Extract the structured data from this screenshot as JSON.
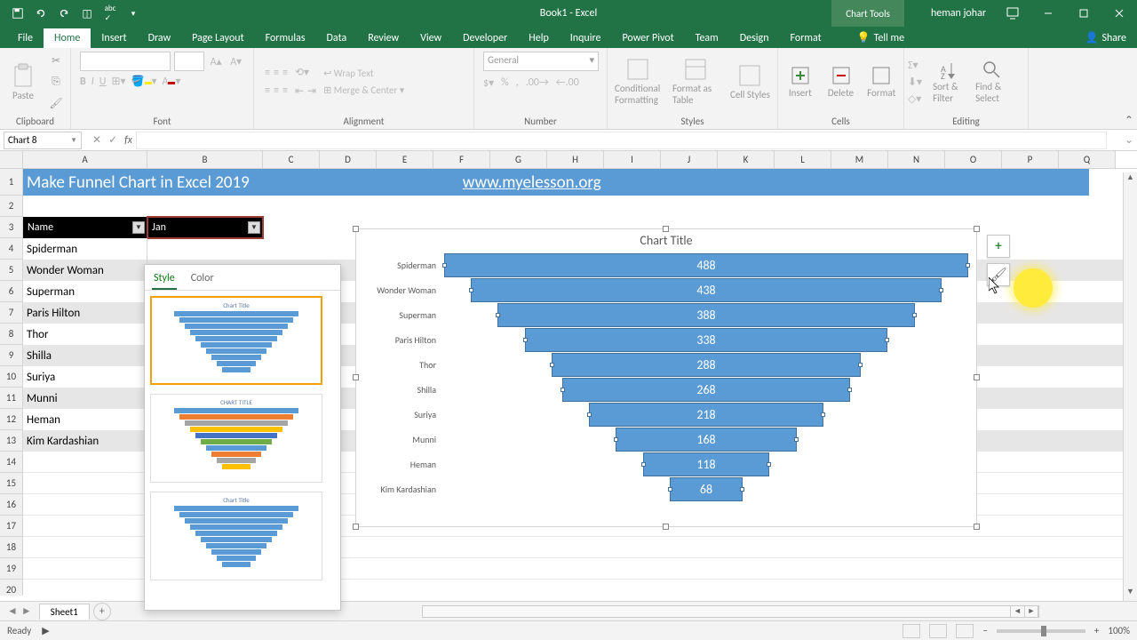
{
  "app": {
    "title": "Book1 - Excel",
    "chart_tools": "Chart Tools",
    "user": "heman johar"
  },
  "tabs": [
    "File",
    "Home",
    "Insert",
    "Draw",
    "Page Layout",
    "Formulas",
    "Data",
    "Review",
    "View",
    "Developer",
    "Help",
    "Inquire",
    "Power Pivot",
    "Team",
    "Design",
    "Format"
  ],
  "tellme": "Tell me",
  "share": "Share",
  "ribbon_groups": {
    "clipboard": "Clipboard",
    "paste": "Paste",
    "font": "Font",
    "alignment": "Alignment",
    "wrap": "Wrap Text",
    "merge": "Merge & Center",
    "number": "Number",
    "number_format": "General",
    "styles": "Styles",
    "cond_format": "Conditional Formatting",
    "format_table": "Format as Table",
    "cell_styles": "Cell Styles",
    "cells": "Cells",
    "insert": "Insert",
    "delete": "Delete",
    "format": "Format",
    "editing": "Editing",
    "sort_filter": "Sort & Filter",
    "find_select": "Find & Select"
  },
  "namebox": "Chart 8",
  "banner": {
    "title": "Make Funnel Chart in Excel 2019",
    "link": "www.myelesson.org"
  },
  "headers": {
    "a": "Name",
    "b": "Jan"
  },
  "columns": [
    "A",
    "B",
    "C",
    "D",
    "E",
    "F",
    "G",
    "H",
    "I",
    "J",
    "K",
    "L",
    "M",
    "N",
    "O",
    "P",
    "Q"
  ],
  "rows": [
    "1",
    "2",
    "3",
    "4",
    "5",
    "6",
    "7",
    "8",
    "9",
    "10",
    "11",
    "12",
    "13",
    "14",
    "15",
    "16",
    "17",
    "18",
    "19",
    "20"
  ],
  "data": [
    "Spiderman",
    "Wonder Woman",
    "Superman",
    "Paris Hilton",
    "Thor",
    "Shilla",
    "Suriya",
    "Munni",
    "Heman",
    "Kim Kardashian"
  ],
  "style_popup": {
    "style_tab": "Style",
    "color_tab": "Color",
    "thumbs": [
      "Chart Title",
      "CHART TITLE",
      "Chart Title"
    ]
  },
  "chart_title": "Chart Title",
  "chart_data": {
    "type": "bar",
    "subtype": "funnel",
    "title": "Chart Title",
    "categories": [
      "Spiderman",
      "Wonder Woman",
      "Superman",
      "Paris Hilton",
      "Thor",
      "Shilla",
      "Suriya",
      "Munni",
      "Heman",
      "Kim Kardashian"
    ],
    "values": [
      488,
      438,
      388,
      338,
      288,
      268,
      218,
      168,
      118,
      68
    ],
    "xlabel": "",
    "ylabel": ""
  },
  "sheet": "Sheet1",
  "status": "Ready",
  "zoom": "100%"
}
